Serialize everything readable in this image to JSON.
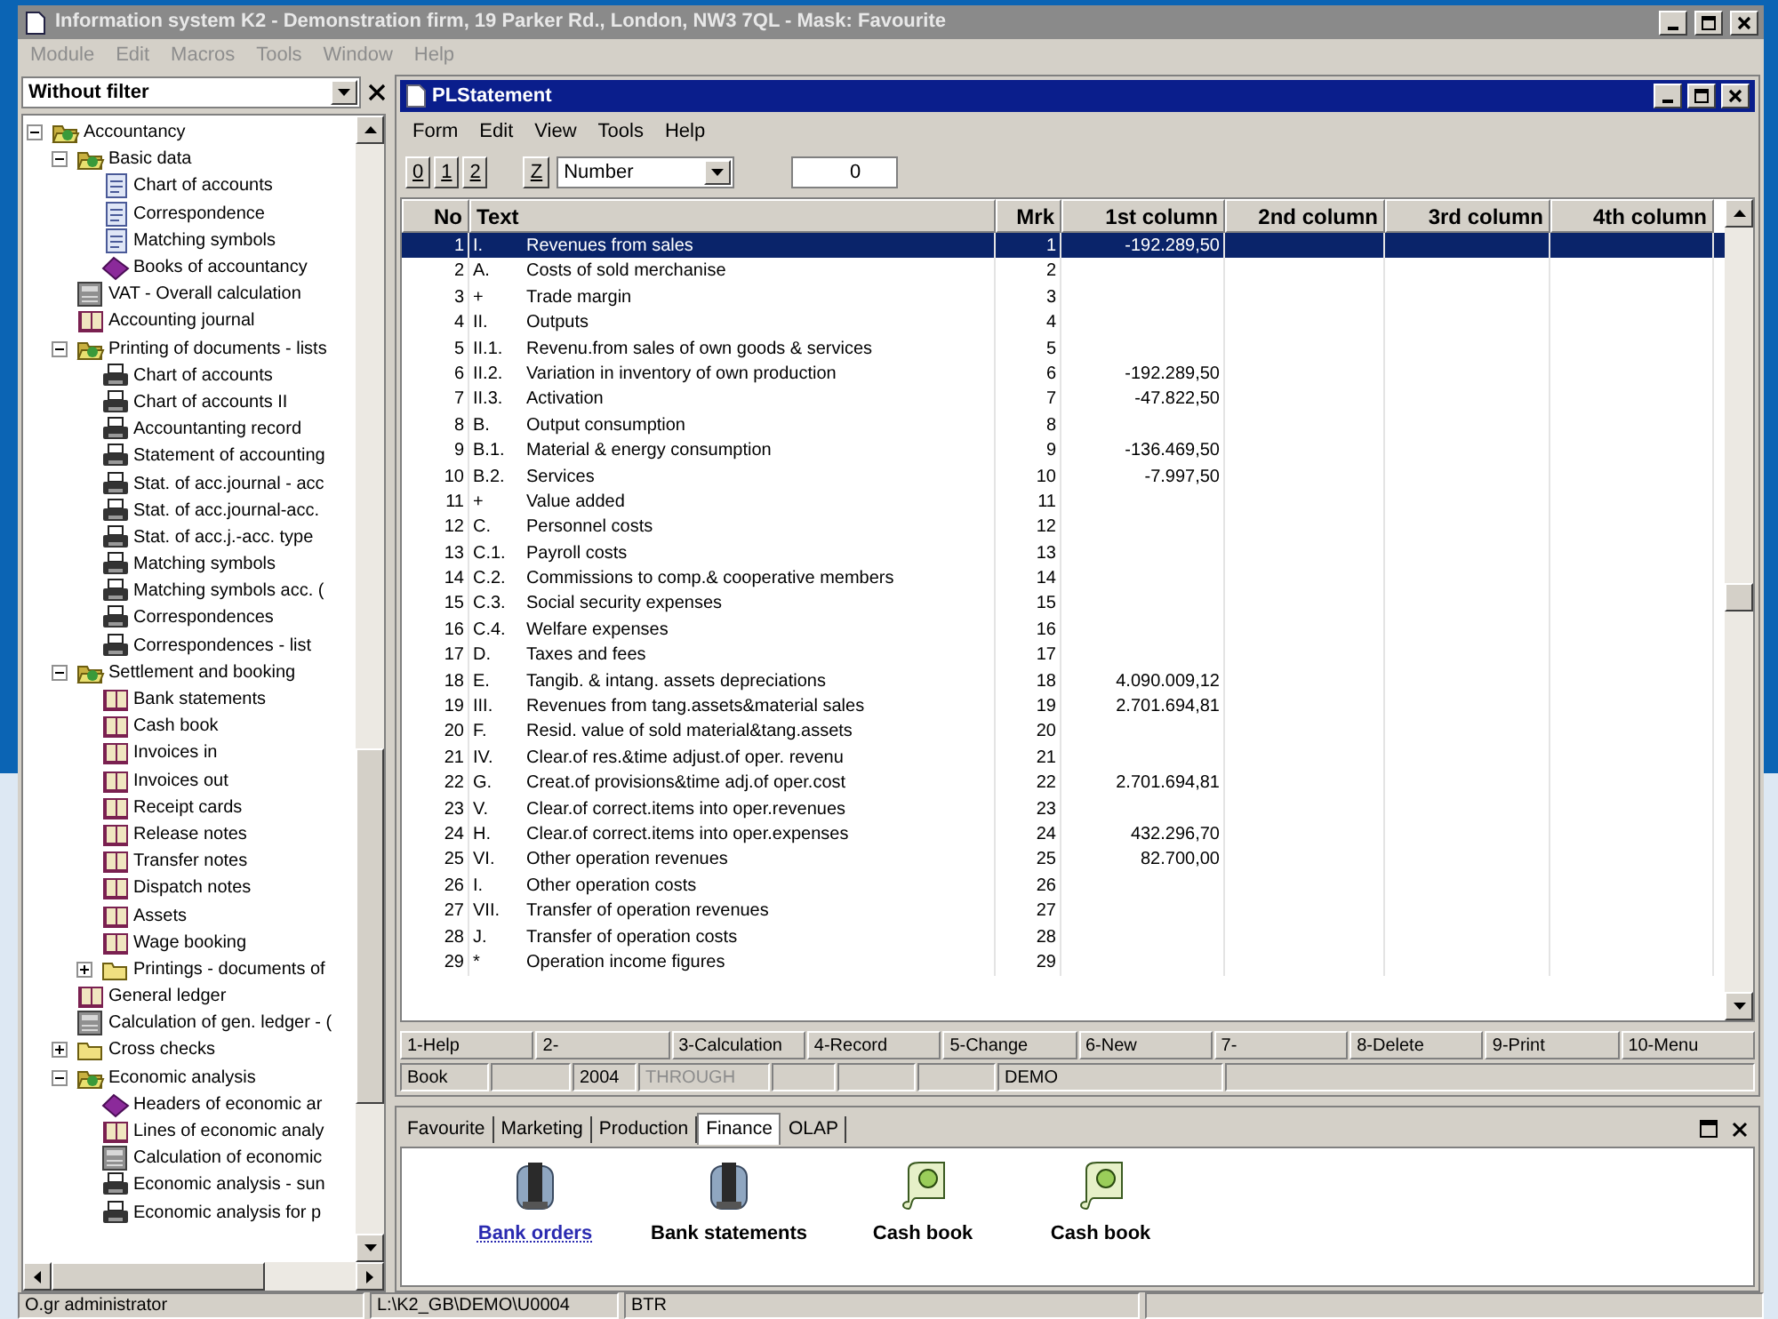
{
  "window": {
    "title": "Information system K2 - Demonstration firm, 19 Parker Rd., London, NW3 7QL - Mask: Favourite",
    "menu": [
      "Module",
      "Edit",
      "Macros",
      "Tools",
      "Window",
      "Help"
    ]
  },
  "sidebar": {
    "filter": "Without filter",
    "tree": [
      {
        "label": "Accountancy",
        "kind": "folder",
        "expanded": true,
        "children": [
          {
            "label": "Basic data",
            "kind": "folder",
            "expanded": true,
            "children": [
              {
                "label": "Chart of accounts",
                "kind": "document"
              },
              {
                "label": "Correspondence",
                "kind": "document"
              },
              {
                "label": "Matching symbols",
                "kind": "document"
              },
              {
                "label": "Books of accountancy",
                "kind": "gem"
              }
            ]
          },
          {
            "label": "VAT - Overall calculation",
            "kind": "calculator"
          },
          {
            "label": "Accounting journal",
            "kind": "book"
          },
          {
            "label": "Printing of documents - lists",
            "kind": "folder",
            "expanded": true,
            "children": [
              {
                "label": "Chart of accounts",
                "kind": "printer"
              },
              {
                "label": "Chart of accounts II",
                "kind": "printer"
              },
              {
                "label": "Accountanting record",
                "kind": "printer"
              },
              {
                "label": "Statement of accounting",
                "kind": "printer"
              },
              {
                "label": "Stat. of acc.journal - acc",
                "kind": "printer"
              },
              {
                "label": "Stat. of acc.journal-acc.",
                "kind": "printer"
              },
              {
                "label": "Stat. of acc.j.-acc. type",
                "kind": "printer"
              },
              {
                "label": "Matching symbols",
                "kind": "printer"
              },
              {
                "label": "Matching symbols acc. (",
                "kind": "printer"
              },
              {
                "label": "Correspondences",
                "kind": "printer"
              },
              {
                "label": "Correspondences - list",
                "kind": "printer"
              }
            ]
          },
          {
            "label": "Settlement and booking",
            "kind": "folder",
            "expanded": true,
            "children": [
              {
                "label": "Bank statements",
                "kind": "book"
              },
              {
                "label": "Cash book",
                "kind": "book"
              },
              {
                "label": "Invoices in",
                "kind": "book"
              },
              {
                "label": "Invoices out",
                "kind": "book"
              },
              {
                "label": "Receipt cards",
                "kind": "book"
              },
              {
                "label": "Release notes",
                "kind": "book"
              },
              {
                "label": "Transfer notes",
                "kind": "book"
              },
              {
                "label": "Dispatch notes",
                "kind": "book"
              },
              {
                "label": "Assets",
                "kind": "book"
              },
              {
                "label": "Wage booking",
                "kind": "book"
              },
              {
                "label": "Printings - documents of",
                "kind": "folder",
                "expanded": false
              }
            ]
          },
          {
            "label": "General ledger",
            "kind": "book"
          },
          {
            "label": "Calculation of gen. ledger - (",
            "kind": "calculator"
          },
          {
            "label": "Cross checks",
            "kind": "folder",
            "expanded": false
          },
          {
            "label": "Economic analysis",
            "kind": "folder",
            "expanded": true,
            "children": [
              {
                "label": "Headers of economic ar",
                "kind": "gem"
              },
              {
                "label": "Lines of economic analy",
                "kind": "book"
              },
              {
                "label": "Calculation of economic",
                "kind": "calculator"
              },
              {
                "label": "Economic analysis - sun",
                "kind": "printer"
              },
              {
                "label": "Economic analysis for p",
                "kind": "printer"
              }
            ]
          }
        ]
      }
    ]
  },
  "document": {
    "title": "PLStatement",
    "menu": [
      "Form",
      "Edit",
      "View",
      "Tools",
      "Help"
    ],
    "toolbar": {
      "buttons": [
        "0",
        "1",
        "2",
        "Z"
      ],
      "sort_field": "Number",
      "value": "0"
    },
    "table": {
      "columns": [
        "No",
        "Text",
        "Mrk",
        "1st column",
        "2nd column",
        "3rd column",
        "4th column"
      ],
      "rows": [
        {
          "no": "1",
          "code": "I.",
          "text": "Revenues from sales",
          "mrk": "1",
          "first_column": "-192.289,50",
          "selected": true
        },
        {
          "no": "2",
          "code": "A.",
          "text": "Costs of sold merchanise",
          "mrk": "2",
          "selected": false
        },
        {
          "no": "3",
          "code": "+",
          "text": "Trade margin",
          "mrk": "3",
          "selected": false
        },
        {
          "no": "4",
          "code": "II.",
          "text": "Outputs",
          "mrk": "4",
          "selected": false
        },
        {
          "no": "5",
          "code": "II.1.",
          "text": "Revenu.from sales of own goods & services",
          "mrk": "5",
          "selected": false
        },
        {
          "no": "6",
          "code": "II.2.",
          "text": "Variation in inventory of own production",
          "mrk": "6",
          "first_column": "-192.289,50",
          "selected": false
        },
        {
          "no": "7",
          "code": "II.3.",
          "text": "Activation",
          "mrk": "7",
          "first_column": "-47.822,50",
          "selected": false
        },
        {
          "no": "8",
          "code": "B.",
          "text": "Output consumption",
          "mrk": "8",
          "selected": false
        },
        {
          "no": "9",
          "code": "B.1.",
          "text": "Material & energy consumption",
          "mrk": "9",
          "first_column": "-136.469,50",
          "selected": false
        },
        {
          "no": "10",
          "code": "B.2.",
          "text": "Services",
          "mrk": "10",
          "first_column": "-7.997,50",
          "selected": false
        },
        {
          "no": "11",
          "code": "+",
          "text": "Value added",
          "mrk": "11",
          "selected": false
        },
        {
          "no": "12",
          "code": "C.",
          "text": "Personnel costs",
          "mrk": "12",
          "selected": false
        },
        {
          "no": "13",
          "code": "C.1.",
          "text": "Payroll costs",
          "mrk": "13",
          "selected": false
        },
        {
          "no": "14",
          "code": "C.2.",
          "text": "Commissions to comp.& cooperative members",
          "mrk": "14",
          "selected": false
        },
        {
          "no": "15",
          "code": "C.3.",
          "text": "Social security expenses",
          "mrk": "15",
          "selected": false
        },
        {
          "no": "16",
          "code": "C.4.",
          "text": "Welfare expenses",
          "mrk": "16",
          "selected": false
        },
        {
          "no": "17",
          "code": "D.",
          "text": "Taxes and fees",
          "mrk": "17",
          "selected": false
        },
        {
          "no": "18",
          "code": "E.",
          "text": "Tangib. & intang. assets depreciations",
          "mrk": "18",
          "first_column": "4.090.009,12",
          "selected": false
        },
        {
          "no": "19",
          "code": "III.",
          "text": "Revenues from tang.assets&material sales",
          "mrk": "19",
          "first_column": "2.701.694,81",
          "selected": false
        },
        {
          "no": "20",
          "code": "F.",
          "text": "Resid. value of sold material&tang.assets",
          "mrk": "20",
          "selected": false
        },
        {
          "no": "21",
          "code": "IV.",
          "text": "Clear.of res.&time adjust.of oper. revenu",
          "mrk": "21",
          "selected": false
        },
        {
          "no": "22",
          "code": "G.",
          "text": "Creat.of provisions&time adj.of oper.cost",
          "mrk": "22",
          "first_column": "2.701.694,81",
          "selected": false
        },
        {
          "no": "23",
          "code": "V.",
          "text": "Clear.of correct.items into oper.revenues",
          "mrk": "23",
          "selected": false
        },
        {
          "no": "24",
          "code": "H.",
          "text": "Clear.of correct.items into oper.expenses",
          "mrk": "24",
          "first_column": "432.296,70",
          "selected": false
        },
        {
          "no": "25",
          "code": "VI.",
          "text": "Other operation revenues",
          "mrk": "25",
          "first_column": "82.700,00",
          "selected": false
        },
        {
          "no": "26",
          "code": "I.",
          "text": "Other operation costs",
          "mrk": "26",
          "selected": false
        },
        {
          "no": "27",
          "code": "VII.",
          "text": "Transfer of operation revenues",
          "mrk": "27",
          "selected": false
        },
        {
          "no": "28",
          "code": "J.",
          "text": "Transfer of operation costs",
          "mrk": "28",
          "selected": false
        },
        {
          "no": "29",
          "code": "*",
          "text": "Operation income figures",
          "mrk": "29",
          "selected": false
        }
      ]
    },
    "function_keys": [
      "1-Help",
      "2-",
      "3-Calculation",
      "4-Record",
      "5-Change",
      "6-New",
      "7-",
      "8-Delete",
      "9-Print",
      "10-Menu"
    ],
    "status_fields": [
      {
        "text": "Book",
        "disabled": false
      },
      {
        "text": "2004",
        "disabled": false
      },
      {
        "text": "THROUGH",
        "disabled": true
      },
      {
        "text": "DEMO",
        "disabled": false
      }
    ]
  },
  "favourites": {
    "tabs": [
      {
        "label": "Favourite",
        "selected": false
      },
      {
        "label": "Marketing",
        "selected": false
      },
      {
        "label": "Production",
        "selected": false
      },
      {
        "label": "Finance",
        "selected": true
      },
      {
        "label": "OLAP",
        "selected": false
      }
    ],
    "shortcuts": [
      {
        "label": "Bank orders",
        "kind": "bank",
        "focused": true
      },
      {
        "label": "Bank statements",
        "kind": "bank",
        "focused": false
      },
      {
        "label": "Cash book",
        "kind": "cashbook",
        "focused": false
      },
      {
        "label": "Cash book",
        "kind": "cashbook",
        "focused": false
      }
    ]
  },
  "status_bar": [
    "O.gr administrator",
    "L:\\K2_GB\\DEMO\\U0004",
    "BTR"
  ]
}
